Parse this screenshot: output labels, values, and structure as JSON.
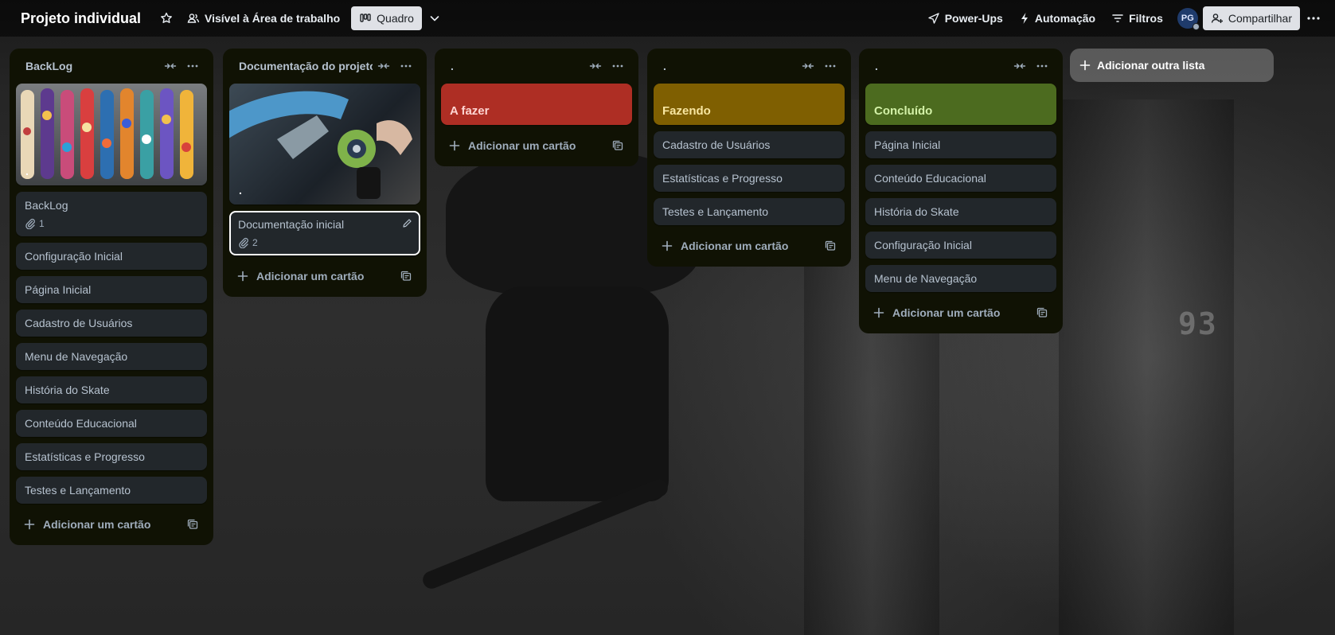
{
  "header": {
    "board_title": "Projeto individual",
    "visibility_label": "Visível à Área de trabalho",
    "view_label": "Quadro",
    "powerups_label": "Power-Ups",
    "automation_label": "Automação",
    "filters_label": "Filtros",
    "avatar_initials": "PG",
    "share_label": "Compartilhar"
  },
  "background": {
    "painted_number": "93"
  },
  "lists": [
    {
      "title": "BackLog",
      "cover_card": {
        "cover_label": "."
      },
      "cards": [
        {
          "title": "BackLog",
          "attachments": "1"
        },
        {
          "title": "Configuração Inicial"
        },
        {
          "title": "Página Inicial"
        },
        {
          "title": "Cadastro de Usuários"
        },
        {
          "title": "Menu de Navegação"
        },
        {
          "title": "História do Skate"
        },
        {
          "title": "Conteúdo Educacional"
        },
        {
          "title": "Estatísticas e Progresso"
        },
        {
          "title": "Testes e Lançamento"
        }
      ],
      "add_card_label": "Adicionar um cartão"
    },
    {
      "title": "Documentação do projeto",
      "cover_card": {
        "cover_label": "."
      },
      "cards": [
        {
          "title": "Documentação inicial",
          "attachments": "2"
        }
      ],
      "add_card_label": "Adicionar um cartão"
    },
    {
      "title": ".",
      "color_card": {
        "title": "A fazer",
        "color": "#ae2e24",
        "text_color": "#ffd5d2"
      },
      "cards": [],
      "add_card_label": "Adicionar um cartão"
    },
    {
      "title": ".",
      "color_card": {
        "title": "Fazendo",
        "color": "#7f5f01",
        "text_color": "#f8e6a0"
      },
      "cards": [
        {
          "title": "Cadastro de Usuários"
        },
        {
          "title": "Estatísticas e Progresso"
        },
        {
          "title": "Testes e Lançamento"
        }
      ],
      "add_card_label": "Adicionar um cartão"
    },
    {
      "title": ".",
      "color_card": {
        "title": "Concluído",
        "color": "#4c6b1f",
        "text_color": "#d3f1a7"
      },
      "cards": [
        {
          "title": "Página Inicial"
        },
        {
          "title": "Conteúdo Educacional"
        },
        {
          "title": "História do Skate"
        },
        {
          "title": "Configuração Inicial"
        },
        {
          "title": "Menu de Navegação"
        }
      ],
      "add_card_label": "Adicionar um cartão"
    }
  ],
  "add_list_label": "Adicionar outra lista"
}
